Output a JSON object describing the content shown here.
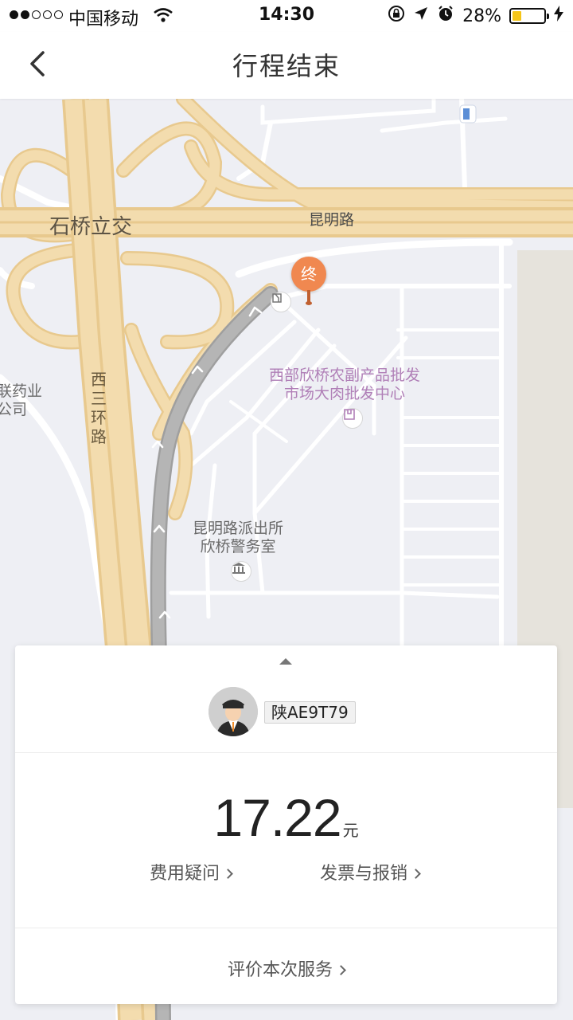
{
  "status_bar": {
    "carrier": "中国移动",
    "time": "14:30",
    "battery": "28%",
    "battery_level": 0.28,
    "signal_bars_filled": 2,
    "signal_bars_total": 5,
    "icons": [
      "wifi-icon",
      "rotation-lock-icon",
      "location-arrow-icon",
      "alarm-icon",
      "charging-icon"
    ]
  },
  "header": {
    "title": "行程结束",
    "back_icon": "chevron-left-icon"
  },
  "map": {
    "labels": {
      "interchange": "石桥立交",
      "kunming_road": "昆明路",
      "west_ring": "西三环路",
      "market_line1": "西部欣桥农副产品批发",
      "market_line2": "市场大肉批发中心",
      "police_line1": "昆明路派出所",
      "police_line2": "欣桥警务室",
      "pharma_line1": "联药业",
      "pharma_line2": "公司"
    },
    "end_marker": "终",
    "colors": {
      "background": "#eeeff4",
      "highway": "#f3dcae",
      "highway_edge": "#e8c98e",
      "road": "#ffffff",
      "route": "#a9a9a9",
      "end_marker": "#f08850"
    }
  },
  "trip_card": {
    "plate": "陕AE9T79",
    "fare_amount": "17.22",
    "fare_unit": "元",
    "fee_question": "费用疑问",
    "invoice": "发票与报销",
    "rate_service": "评价本次服务"
  }
}
